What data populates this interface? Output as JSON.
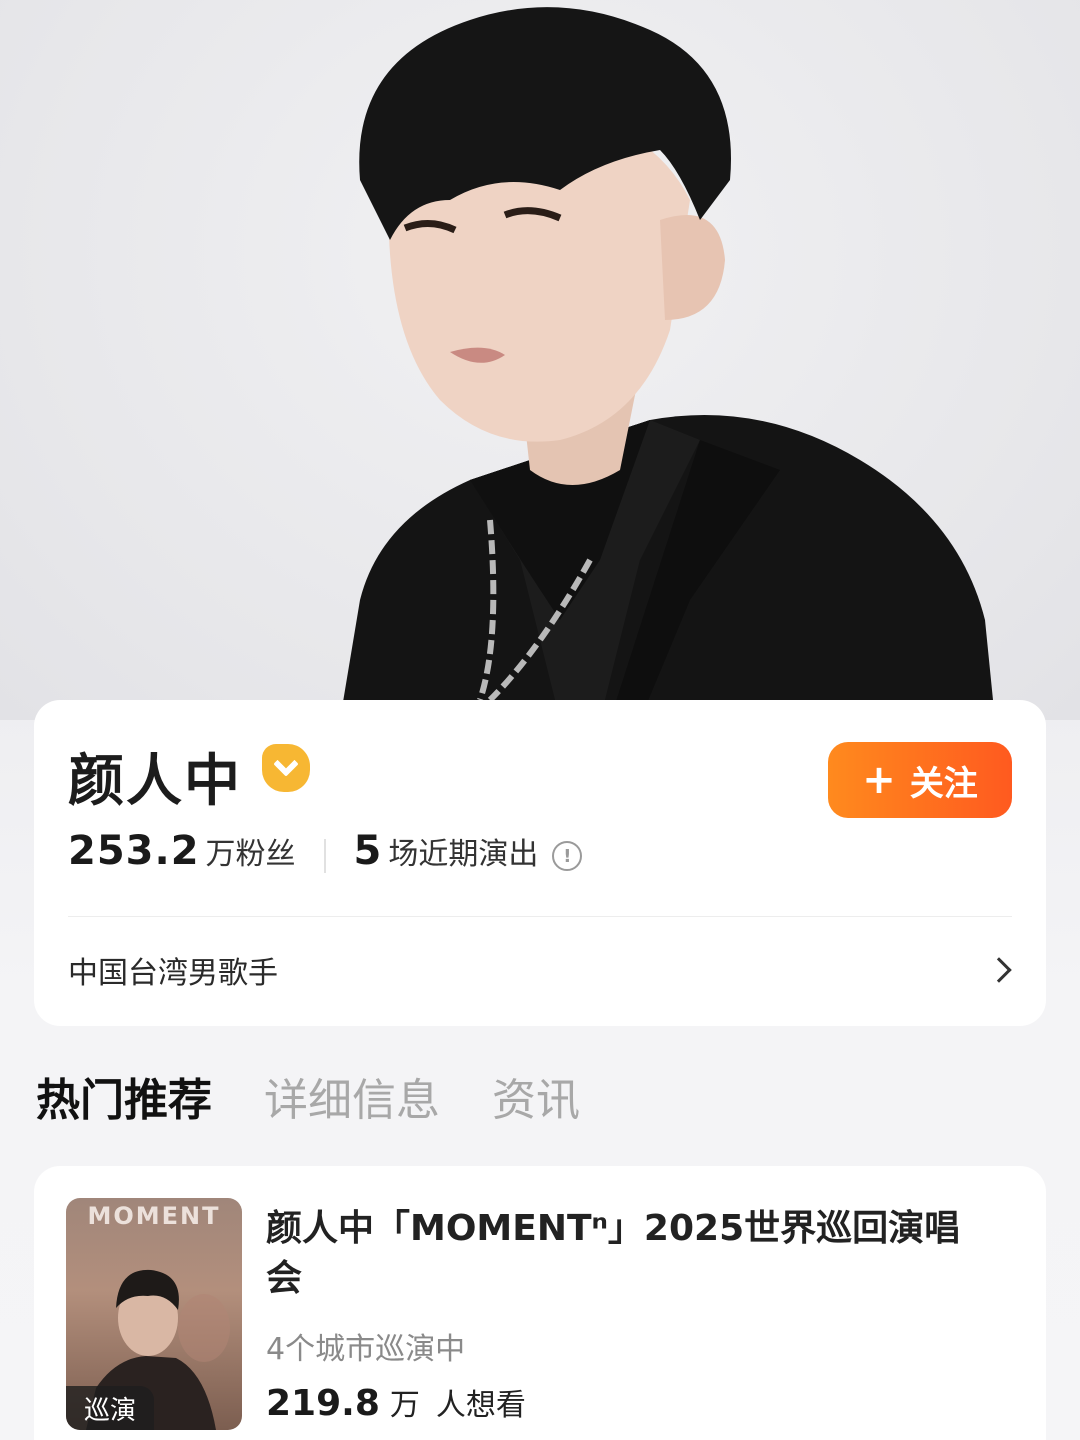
{
  "profile": {
    "name": "颜人中",
    "follow_label": "关注",
    "fans_count": "253.2",
    "fans_unit": "万粉丝",
    "shows_count": "5",
    "shows_label": "场近期演出",
    "bio": "中国台湾男歌手"
  },
  "tabs": [
    {
      "label": "热门推荐",
      "active": true
    },
    {
      "label": "详细信息",
      "active": false
    },
    {
      "label": "资讯",
      "active": false
    }
  ],
  "event": {
    "title": "颜人中「MOMENTⁿ」2025世界巡回演唱会",
    "poster_text": "MOMENT",
    "poster_badge": "巡演",
    "cities": "4个城市巡演中",
    "want_count": "219.8",
    "want_unit": "万",
    "want_label": "人想看"
  },
  "colors": {
    "accent_orange": "#ff6a1f",
    "verified_gold": "#f7b733",
    "tab_underline": "#ff9a1e"
  }
}
